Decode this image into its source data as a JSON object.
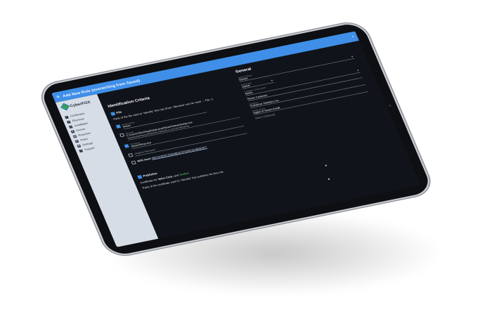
{
  "app": {
    "logo_text": "CyberFOX",
    "topbar_title": "Add New Rule (overwriting from Saved)",
    "topbar_right": "×"
  },
  "sidebar": {
    "items": [
      {
        "icon": "check-icon",
        "label": "Certificates"
      },
      {
        "icon": "rules-icon",
        "label": "Elements"
      },
      {
        "icon": "folder-icon",
        "label": "Installation"
      },
      {
        "icon": "users-icon",
        "label": "Events"
      },
      {
        "icon": "report-icon",
        "label": "Requests"
      },
      {
        "icon": "rules-icon",
        "label": "Rules"
      },
      {
        "icon": "gear-icon",
        "label": "Settings"
      },
      {
        "icon": "help-icon",
        "label": "Support"
      }
    ]
  },
  "main": {
    "left": {
      "heading": "Identification Criteria",
      "file_section": "File",
      "file_desc": "Parts of the file used to \"identify\" this rule (from: 'filename' can be used → File ↑)",
      "product_name": {
        "label": "Product Name",
        "value": "Steam",
        "checked": true
      },
      "file_path": {
        "label": "File Path",
        "value": "C:\\Users\\Client\\AppData\\Local\\Steam\\SteamSetup.exe",
        "help": "Extensions/Names/Path/File (defaults to just the filename)",
        "checked": false
      },
      "file_name": {
        "label": "File Name",
        "value": "SteamSetup.exe",
        "checked": true
      },
      "original_filename": {
        "placeholder": "Original Filename",
        "checked": false
      },
      "md5": {
        "label": "MD5 Hash",
        "value": "5BF3A3E5C7D9A8B1E1F0D6C2A4B5E9F7",
        "checked": false
      },
      "publisher_section": "Publisher",
      "publisher_desc_prefix": "Certificate for",
      "publisher_name": "Valve Corp.",
      "publisher_desc_suffix": "and",
      "publisher_status": "Verified",
      "publisher_note": "Parts of the certificate used to \"identify\" this publisher for this rule"
    },
    "right": {
      "heading": "General",
      "fields": [
        {
          "label": "Approval Status",
          "value": "Denied",
          "dropdown": true
        },
        {
          "label": "Rule Scope",
          "value": "Global",
          "dropdown": true
        },
        {
          "label": "Computer / Group Name",
          "value": "Admin",
          "dropdown": true
        },
        {
          "label": "",
          "value": "Steam Company",
          "dropdown": false
        },
        {
          "label": "Company",
          "value": "Enterprise Solutions Inc.",
          "dropdown": false
        },
        {
          "label": "Product Name",
          "value": "Digital of Steam install",
          "dropdown": false
        },
        {
          "label": "",
          "value": "Notes (Optional)",
          "dropdown": false
        }
      ]
    }
  },
  "colors": {
    "accent": "#3f8fe8",
    "sidebar_bg": "#d7dde6",
    "screen_bg": "#10141a",
    "verified": "#63d36d"
  }
}
